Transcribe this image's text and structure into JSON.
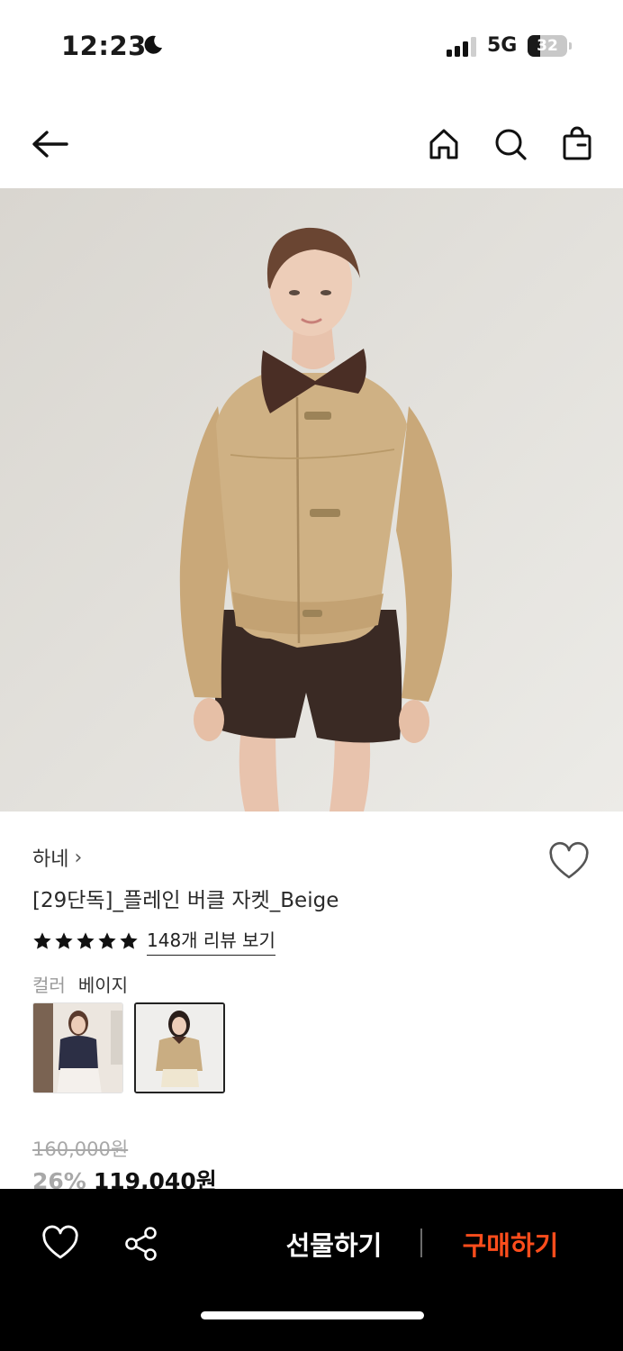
{
  "status_bar": {
    "time": "12:23",
    "network": "5G",
    "battery": "32",
    "battery_level": 0.32,
    "moon_icon": "moon-icon",
    "signal_icon": "cellular-signal-icon"
  },
  "nav": {
    "back_icon": "arrow-left-icon",
    "home_icon": "home-icon",
    "search_icon": "search-icon",
    "bag_icon": "shopping-bag-icon"
  },
  "product": {
    "brand": "하네",
    "brand_chevron": "›",
    "title": "[29단독]_플레인 버클 자켓_Beige",
    "rating_stars": 5,
    "review_link": "148개 리뷰 보기",
    "option_label": "컬러",
    "option_value": "베이지",
    "original_price": "160,000원",
    "discount": "26%",
    "price": "119,040원"
  },
  "bottom_bar": {
    "wish_icon": "heart-icon",
    "share_icon": "share-icon",
    "gift_label": "선물하기",
    "buy_label": "구매하기"
  },
  "colors": {
    "accent": "#ff4d1c",
    "bottom_bar_bg": "#000000",
    "muted_text": "#a8a8a8"
  }
}
